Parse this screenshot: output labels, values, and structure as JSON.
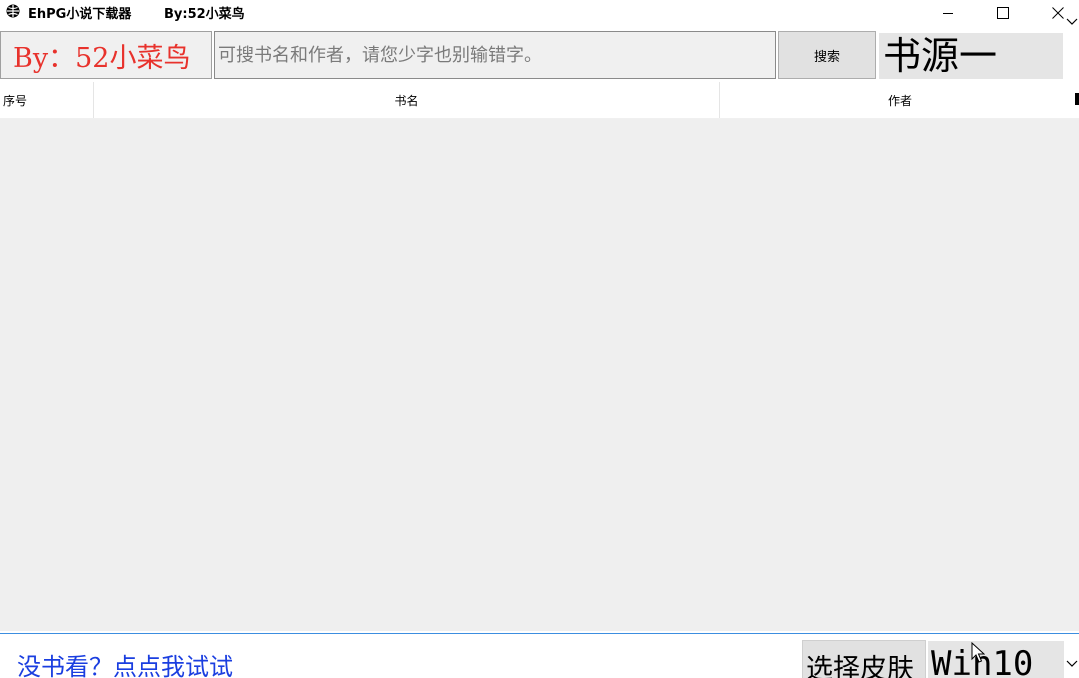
{
  "window": {
    "title": "EhPG小说下载器",
    "author": "By:52小菜鸟",
    "icon": "app-globe-icon"
  },
  "search": {
    "author_label": "By：52小菜鸟",
    "placeholder": "可搜书名和作者，请您少字也别输错字。",
    "button_label": "搜索",
    "source_value": "书源一"
  },
  "table": {
    "columns": [
      "序号",
      "书名",
      "作者"
    ],
    "rows": []
  },
  "footer": {
    "link_label": "没书看？点点我试试",
    "skin_button_label": "选择皮肤",
    "skin_value": "Win10"
  },
  "colors": {
    "author_red": "#e8322c",
    "link_blue": "#1a3ee0",
    "divider_blue": "#3c8ee0"
  }
}
